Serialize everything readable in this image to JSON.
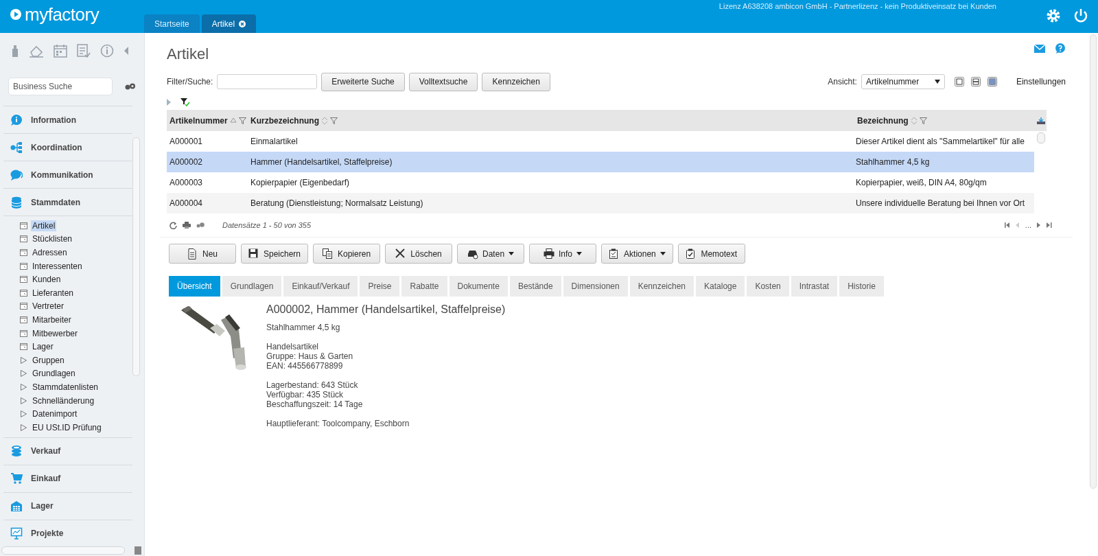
{
  "header": {
    "logo": "myfactory",
    "license": "Lizenz A638208 ambicon GmbH - Partnerlizenz - kein Produktiveinsatz bei Kunden",
    "tabs": [
      {
        "label": "Startseite",
        "selected": false,
        "closable": false
      },
      {
        "label": "Artikel",
        "selected": true,
        "closable": true
      }
    ]
  },
  "sidebar": {
    "search": {
      "placeholder": "Business Suche"
    },
    "sections": [
      {
        "label": "Information",
        "expanded": false
      },
      {
        "label": "Koordination",
        "expanded": false
      },
      {
        "label": "Kommunikation",
        "expanded": false
      },
      {
        "label": "Stammdaten",
        "expanded": true,
        "children": [
          {
            "label": "Artikel",
            "kind": "page",
            "selected": true
          },
          {
            "label": "Stücklisten",
            "kind": "page",
            "selected": false
          },
          {
            "label": "Adressen",
            "kind": "page",
            "selected": false
          },
          {
            "label": "Interessenten",
            "kind": "page",
            "selected": false
          },
          {
            "label": "Kunden",
            "kind": "page",
            "selected": false
          },
          {
            "label": "Lieferanten",
            "kind": "page",
            "selected": false
          },
          {
            "label": "Vertreter",
            "kind": "page",
            "selected": false
          },
          {
            "label": "Mitarbeiter",
            "kind": "page",
            "selected": false
          },
          {
            "label": "Mitbewerber",
            "kind": "page",
            "selected": false
          },
          {
            "label": "Lager",
            "kind": "page",
            "selected": false
          },
          {
            "label": "Gruppen",
            "kind": "folder",
            "selected": false
          },
          {
            "label": "Grundlagen",
            "kind": "folder",
            "selected": false
          },
          {
            "label": "Stammdatenlisten",
            "kind": "folder",
            "selected": false
          },
          {
            "label": "Schnelländerung",
            "kind": "folder",
            "selected": false
          },
          {
            "label": "Datenimport",
            "kind": "folder",
            "selected": false
          },
          {
            "label": "EU USt.ID Prüfung",
            "kind": "folder",
            "selected": false
          }
        ]
      },
      {
        "label": "Verkauf",
        "expanded": false
      },
      {
        "label": "Einkauf",
        "expanded": false
      },
      {
        "label": "Lager",
        "expanded": false
      },
      {
        "label": "Projekte",
        "expanded": false
      }
    ]
  },
  "main": {
    "title": "Artikel",
    "filter": {
      "label": "Filter/Suche:",
      "buttons": [
        "Erweiterte Suche",
        "Volltextsuche",
        "Kennzeichen"
      ]
    },
    "view": {
      "label": "Ansicht:",
      "value": "Artikelnummer",
      "modes": [
        {
          "selected": false
        },
        {
          "selected": false
        },
        {
          "selected": true
        }
      ],
      "settings": "Einstellungen"
    },
    "table": {
      "columns": [
        {
          "label": "Artikelnummer",
          "sorted": true
        },
        {
          "label": "Kurzbezeichnung",
          "sorted": false
        },
        {
          "label": "Bezeichnung",
          "sorted": false
        }
      ],
      "rows": [
        {
          "cells": [
            "A000001",
            "Einmalartikel",
            "Dieser Artikel dient als \"Sammelartikel\" für alle"
          ],
          "selected": false
        },
        {
          "cells": [
            "A000002",
            "Hammer (Handelsartikel, Staffelpreise)",
            "Stahlhammer 4,5 kg"
          ],
          "selected": true
        },
        {
          "cells": [
            "A000003",
            "Kopierpapier (Eigenbedarf)",
            "Kopierpapier, weiß, DIN A4, 80g/qm"
          ],
          "selected": false
        },
        {
          "cells": [
            "A000004",
            "Beratung (Dienstleistung; Normalsatz Leistung)",
            "Unsere individuelle Beratung bei Ihnen vor Ort"
          ],
          "selected": false
        }
      ],
      "records": "Datensätze 1 - 50 von 355",
      "pager_ellipsis": "..."
    },
    "actions": [
      {
        "label": "Neu",
        "dropdown": false
      },
      {
        "label": "Speichern",
        "dropdown": false
      },
      {
        "label": "Kopieren",
        "dropdown": false
      },
      {
        "label": "Löschen",
        "dropdown": false
      },
      {
        "label": "Daten",
        "dropdown": true
      },
      {
        "label": "Info",
        "dropdown": true
      },
      {
        "label": "Aktionen",
        "dropdown": true
      },
      {
        "label": "Memotext",
        "dropdown": false
      }
    ],
    "detail_tabs": [
      {
        "label": "Übersicht",
        "selected": true
      },
      {
        "label": "Grundlagen",
        "selected": false
      },
      {
        "label": "Einkauf/Verkauf",
        "selected": false
      },
      {
        "label": "Preise",
        "selected": false
      },
      {
        "label": "Rabatte",
        "selected": false
      },
      {
        "label": "Dokumente",
        "selected": false
      },
      {
        "label": "Bestände",
        "selected": false
      },
      {
        "label": "Dimensionen",
        "selected": false
      },
      {
        "label": "Kennzeichen",
        "selected": false
      },
      {
        "label": "Kataloge",
        "selected": false
      },
      {
        "label": "Kosten",
        "selected": false
      },
      {
        "label": "Intrastat",
        "selected": false
      },
      {
        "label": "Historie",
        "selected": false
      }
    ],
    "detail": {
      "image": {
        "kind": "picture"
      },
      "title": "A000002, Hammer (Handelsartikel, Staffelpreise)",
      "blocks": [
        [
          "Stahlhammer 4,5 kg"
        ],
        [
          "Handelsartikel",
          "Gruppe: Haus & Garten",
          "EAN: 445566778899"
        ],
        [
          "Lagerbestand: 643 Stück",
          "Verfügbar: 435 Stück",
          "Beschaffungszeit: 14 Tage"
        ],
        [
          "Hauptlieferant: Toolcompany, Eschborn"
        ]
      ]
    }
  }
}
